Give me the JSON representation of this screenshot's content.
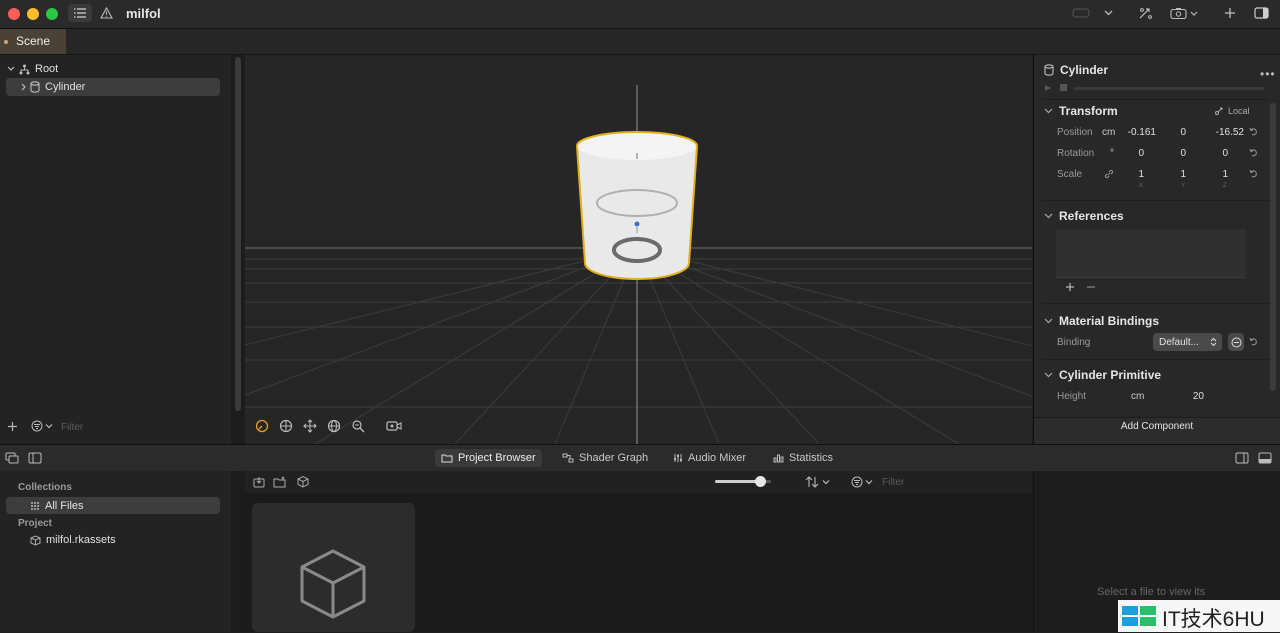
{
  "window": {
    "title": "milfol",
    "icons": [
      "sidebar-toggle-icon",
      "warning-icon",
      "device-icon",
      "chevron-down-icon",
      "share-icon",
      "camera-icon",
      "plus-icon",
      "inspector-toggle-icon"
    ]
  },
  "scene_tab": {
    "label": "Scene"
  },
  "hierarchy": {
    "items": [
      {
        "label": "Root",
        "icon": "hierarchy-icon"
      },
      {
        "label": "Cylinder",
        "icon": "cylinder-icon"
      }
    ],
    "filter_placeholder": "Filter"
  },
  "inspector": {
    "entity_name": "Cylinder",
    "transform": {
      "title": "Transform",
      "space": "Local",
      "position": {
        "label": "Position",
        "unit": "cm",
        "x": "-0.161",
        "y": "0",
        "z": "-16.52"
      },
      "rotation": {
        "label": "Rotation",
        "unit": "°",
        "x": "0",
        "y": "0",
        "z": "0"
      },
      "scale": {
        "label": "Scale",
        "x": "1",
        "y": "1",
        "z": "1"
      },
      "axis": {
        "x": "X",
        "y": "Y",
        "z": "Z"
      }
    },
    "references": {
      "title": "References"
    },
    "material_bindings": {
      "title": "Material Bindings",
      "binding_label": "Binding",
      "binding_value": "Default..."
    },
    "cylinder_primitive": {
      "title": "Cylinder Primitive",
      "height_label": "Height",
      "height_unit": "cm",
      "height_value": "20"
    },
    "add_component": "Add Component"
  },
  "bottom_tabs": [
    {
      "label": "Project Browser",
      "icon": "folder-icon",
      "active": true
    },
    {
      "label": "Shader Graph",
      "icon": "shader-graph-icon",
      "active": false
    },
    {
      "label": "Audio Mixer",
      "icon": "audio-mixer-icon",
      "active": false
    },
    {
      "label": "Statistics",
      "icon": "statistics-icon",
      "active": false
    }
  ],
  "collections": {
    "header": "Collections",
    "all_files": "All Files",
    "project_header": "Project",
    "project_file": "milfol.rkassets"
  },
  "browser": {
    "filter_placeholder": "Filter",
    "zoom_level": 0.82
  },
  "preview": {
    "empty_text": "Select a file to view its"
  },
  "watermark": {
    "text": "IT技术6HU"
  },
  "colors": {
    "accent": "#e0b020",
    "selection": "#3d3d3d",
    "scene_tab": "#4a4236"
  }
}
